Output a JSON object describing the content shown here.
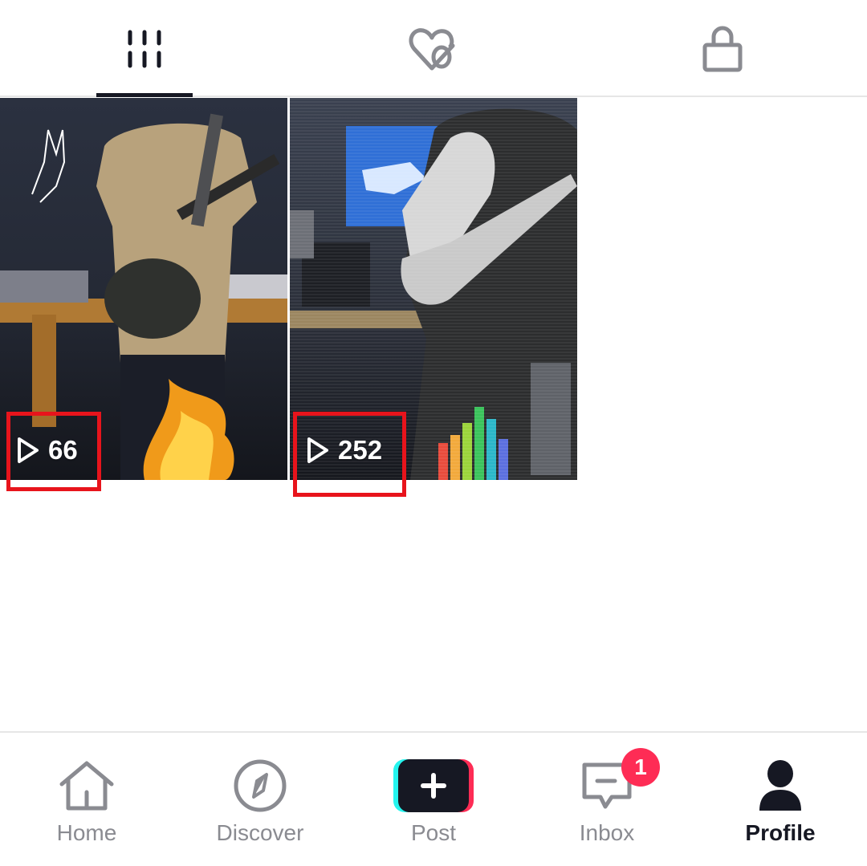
{
  "profile_tabs": [
    {
      "name": "videos",
      "icon": "grid-icon",
      "active": true
    },
    {
      "name": "liked",
      "icon": "hidden-heart-icon",
      "active": false
    },
    {
      "name": "private",
      "icon": "lock-icon",
      "active": false
    }
  ],
  "videos": [
    {
      "views": "66",
      "play_icon": "play-icon"
    },
    {
      "views": "252",
      "play_icon": "play-icon"
    }
  ],
  "colors": {
    "dark": "#161823",
    "inactive": "#8a8b91",
    "badge": "#fe2c55",
    "highlight_box": "#e8141c",
    "post_left_accent": "#25f4ee",
    "post_right_accent": "#fe2c55"
  },
  "bottom_nav": {
    "home": {
      "label": "Home",
      "icon": "home-icon"
    },
    "discover": {
      "label": "Discover",
      "icon": "compass-icon"
    },
    "post": {
      "label": "Post",
      "icon": "plus-icon"
    },
    "inbox": {
      "label": "Inbox",
      "icon": "message-icon",
      "badge": "1"
    },
    "profile": {
      "label": "Profile",
      "icon": "person-icon",
      "active": true
    }
  }
}
